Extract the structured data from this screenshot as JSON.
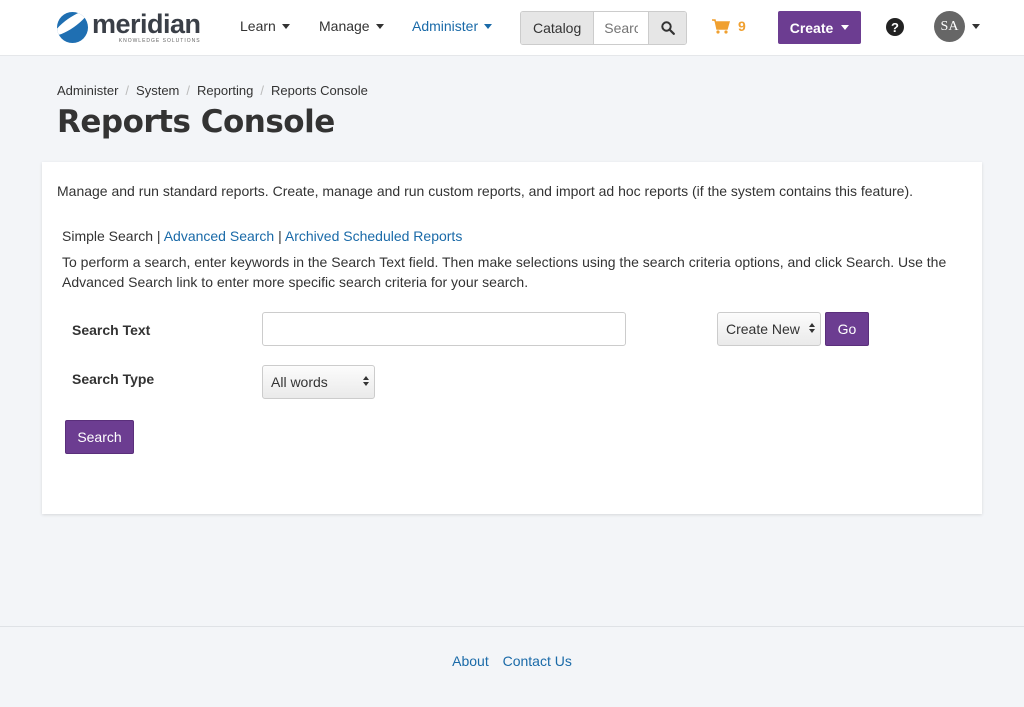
{
  "brand": {
    "name": "meridian",
    "tagline": "KNOWLEDGE SOLUTIONS"
  },
  "nav": {
    "learn": "Learn",
    "manage": "Manage",
    "administer": "Administer",
    "catalog": "Catalog",
    "search_placeholder": "Search",
    "cart_count": "9",
    "create": "Create",
    "help": "?",
    "avatar_initials": "SA"
  },
  "breadcrumb": [
    "Administer",
    "System",
    "Reporting",
    "Reports Console"
  ],
  "page_title": "Reports Console",
  "intro": "Manage and run standard reports. Create, manage and run custom reports, and import ad hoc reports (if the system contains this feature).",
  "search_links": {
    "simple": "Simple Search",
    "advanced": "Advanced Search",
    "archived": "Archived Scheduled Reports"
  },
  "instructions": "To perform a search, enter keywords in the Search Text field. Then make selections using the search criteria options, and click Search. Use the Advanced Search link to enter more specific search criteria for your search.",
  "form": {
    "search_text_label": "Search Text",
    "search_text_value": "",
    "search_type_label": "Search Type",
    "search_type_value": "All words",
    "create_new_value": "Create New",
    "go_label": "Go",
    "search_label": "Search"
  },
  "footer": {
    "about": "About",
    "contact": "Contact Us"
  },
  "colors": {
    "accent": "#6c3d91",
    "link": "#1a6aa8",
    "cart": "#f0a030"
  }
}
